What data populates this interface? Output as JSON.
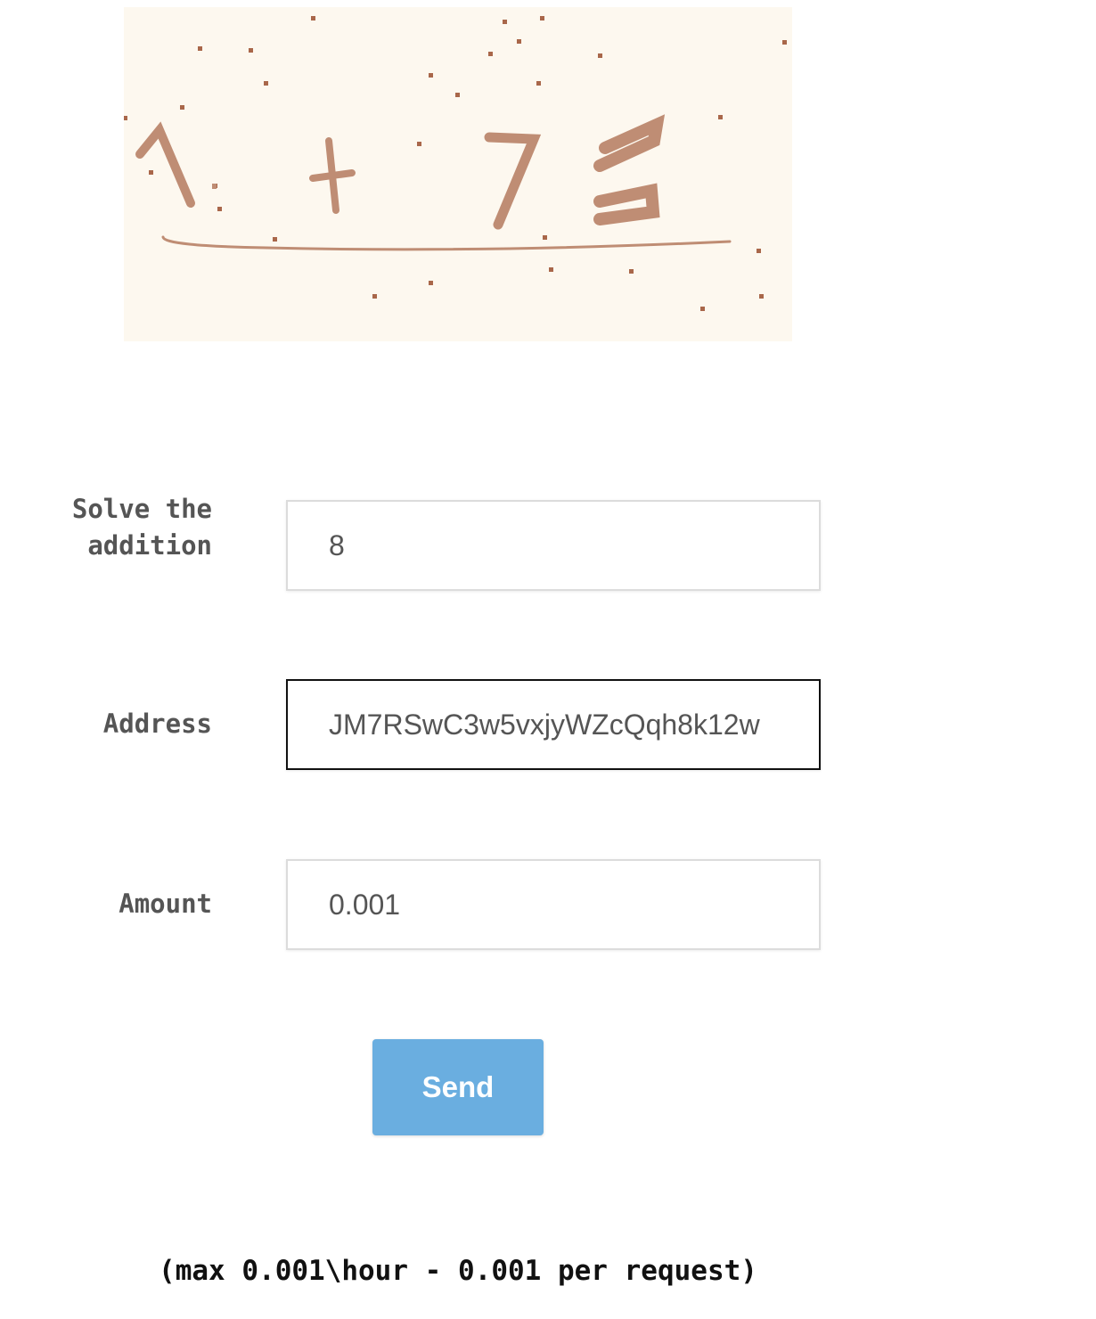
{
  "captcha": {
    "expression": "1 + 7 =",
    "ink_color": "#b98a72",
    "background_color": "#fdf8ef"
  },
  "form": {
    "answer": {
      "label": "Solve the\naddition",
      "value": "8"
    },
    "address": {
      "label": "Address",
      "value": "JM7RSwC3w5vxjyWZcQqh8k12w"
    },
    "amount": {
      "label": "Amount",
      "value": "0.001"
    }
  },
  "send_button": {
    "label": "Send",
    "color": "#6aaee0"
  },
  "limit_note": "(max 0.001\\hour - 0.001 per request)"
}
